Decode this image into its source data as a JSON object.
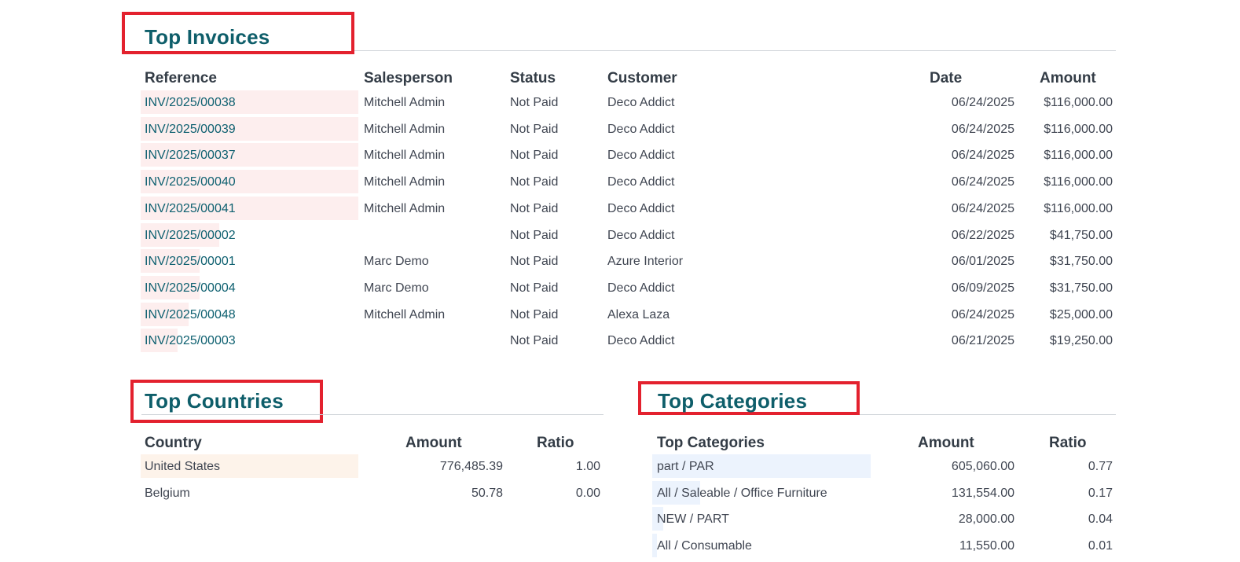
{
  "colors": {
    "title": "#0e5e6a",
    "link": "#0e6070",
    "highlight_red": "#e3212e",
    "bar_invoices": "#fdeeee",
    "bar_countries": "#fdf3ea",
    "bar_categories": "#ecf3fd"
  },
  "invoices": {
    "title": "Top Invoices",
    "headers": {
      "reference": "Reference",
      "salesperson": "Salesperson",
      "status": "Status",
      "customer": "Customer",
      "date": "Date",
      "amount": "Amount"
    },
    "rows": [
      {
        "reference": "INV/2025/00038",
        "salesperson": "Mitchell Admin",
        "status": "Not Paid",
        "customer": "Deco Addict",
        "date": "06/24/2025",
        "amount": "$116,000.00",
        "share": 1.0
      },
      {
        "reference": "INV/2025/00039",
        "salesperson": "Mitchell Admin",
        "status": "Not Paid",
        "customer": "Deco Addict",
        "date": "06/24/2025",
        "amount": "$116,000.00",
        "share": 1.0
      },
      {
        "reference": "INV/2025/00037",
        "salesperson": "Mitchell Admin",
        "status": "Not Paid",
        "customer": "Deco Addict",
        "date": "06/24/2025",
        "amount": "$116,000.00",
        "share": 1.0
      },
      {
        "reference": "INV/2025/00040",
        "salesperson": "Mitchell Admin",
        "status": "Not Paid",
        "customer": "Deco Addict",
        "date": "06/24/2025",
        "amount": "$116,000.00",
        "share": 1.0
      },
      {
        "reference": "INV/2025/00041",
        "salesperson": "Mitchell Admin",
        "status": "Not Paid",
        "customer": "Deco Addict",
        "date": "06/24/2025",
        "amount": "$116,000.00",
        "share": 1.0
      },
      {
        "reference": "INV/2025/00002",
        "salesperson": "",
        "status": "Not Paid",
        "customer": "Deco Addict",
        "date": "06/22/2025",
        "amount": "$41,750.00",
        "share": 0.36
      },
      {
        "reference": "INV/2025/00001",
        "salesperson": "Marc Demo",
        "status": "Not Paid",
        "customer": "Azure Interior",
        "date": "06/01/2025",
        "amount": "$31,750.00",
        "share": 0.27
      },
      {
        "reference": "INV/2025/00004",
        "salesperson": "Marc Demo",
        "status": "Not Paid",
        "customer": "Deco Addict",
        "date": "06/09/2025",
        "amount": "$31,750.00",
        "share": 0.27
      },
      {
        "reference": "INV/2025/00048",
        "salesperson": "Mitchell Admin",
        "status": "Not Paid",
        "customer": "Alexa Laza",
        "date": "06/24/2025",
        "amount": "$25,000.00",
        "share": 0.22
      },
      {
        "reference": "INV/2025/00003",
        "salesperson": "",
        "status": "Not Paid",
        "customer": "Deco Addict",
        "date": "06/21/2025",
        "amount": "$19,250.00",
        "share": 0.17
      }
    ]
  },
  "countries": {
    "title": "Top Countries",
    "headers": {
      "country": "Country",
      "amount": "Amount",
      "ratio": "Ratio"
    },
    "rows": [
      {
        "country": "United States",
        "amount": "776,485.39",
        "ratio": "1.00",
        "share": 1.0
      },
      {
        "country": "Belgium",
        "amount": "50.78",
        "ratio": "0.00",
        "share": 0.0
      }
    ]
  },
  "categories": {
    "title": "Top Categories",
    "headers": {
      "category": "Top Categories",
      "amount": "Amount",
      "ratio": "Ratio"
    },
    "rows": [
      {
        "category": "part / PAR",
        "amount": "605,060.00",
        "ratio": "0.77",
        "share": 1.0
      },
      {
        "category": "All / Saleable / Office Furniture",
        "amount": "131,554.00",
        "ratio": "0.17",
        "share": 0.22
      },
      {
        "category": "NEW / PART",
        "amount": "28,000.00",
        "ratio": "0.04",
        "share": 0.05
      },
      {
        "category": "All / Consumable",
        "amount": "11,550.00",
        "ratio": "0.01",
        "share": 0.02
      }
    ]
  }
}
